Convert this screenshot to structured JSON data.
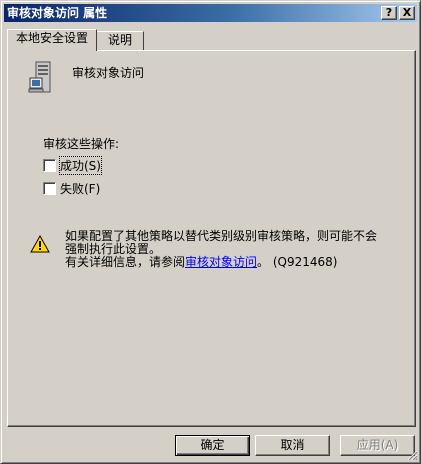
{
  "window": {
    "title": "审核对象访问 属性",
    "help_button": "?",
    "close_button": "X"
  },
  "tabs": [
    {
      "label": "本地安全设置",
      "active": true
    },
    {
      "label": "说明",
      "active": false
    }
  ],
  "policy": {
    "icon": "server-computer-icon",
    "name": "审核对象访问"
  },
  "audit": {
    "group_label": "审核这些操作:",
    "options": [
      {
        "label": "成功(S)",
        "checked": false
      },
      {
        "label": "失败(F)",
        "checked": false
      }
    ]
  },
  "warning": {
    "icon": "warning-triangle-icon",
    "line1": "如果配置了其他策略以替代类别级别审核策略，则可能不会",
    "line2": "强制执行此设置。",
    "line3_prefix": "有关详细信息，请参阅",
    "link_text": "审核对象访问",
    "line3_suffix": "。 (Q921468)"
  },
  "buttons": {
    "ok": "确定",
    "cancel": "取消",
    "apply": "应用(A)"
  }
}
